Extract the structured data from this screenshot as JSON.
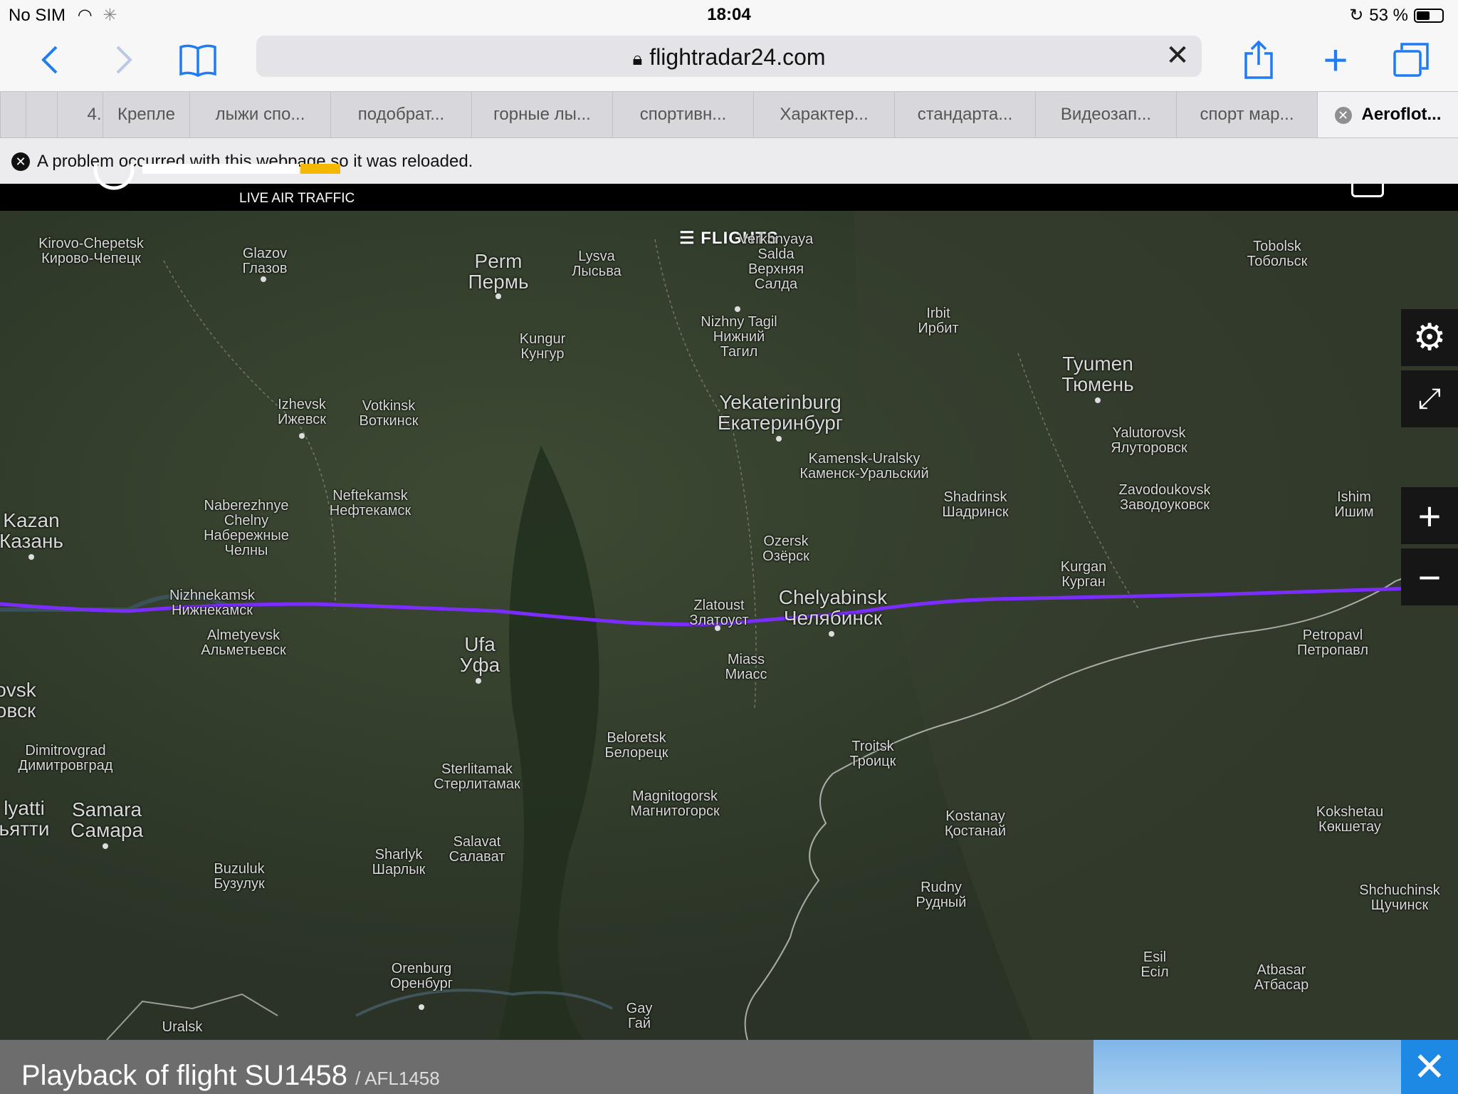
{
  "status": {
    "carrier": "No SIM",
    "time": "18:04",
    "battery": "53 %",
    "battery_level": 0.53
  },
  "toolbar": {
    "url": "flightradar24.com",
    "lock_icon": "lock-icon"
  },
  "tabs": [
    {
      "label": ""
    },
    {
      "label": "4."
    },
    {
      "label": "Крепле"
    },
    {
      "label": "лыжи спо..."
    },
    {
      "label": "подобрат..."
    },
    {
      "label": "горные лы..."
    },
    {
      "label": "спортивн..."
    },
    {
      "label": "Характер..."
    },
    {
      "label": "стандарта..."
    },
    {
      "label": "Видеозап..."
    },
    {
      "label": "спорт мар..."
    },
    {
      "label": "Aeroflot..."
    }
  ],
  "banner": {
    "message": "A problem occurred with this webpage so it was reloaded."
  },
  "site": {
    "tagline": "LIVE AIR TRAFFIC",
    "flights_button": "FLIGHTS"
  },
  "cities": [
    {
      "name": "Kirovo-Chepetsk\nКирово-Чепецк",
      "size": "small"
    },
    {
      "name": "Glazov\nГлазов",
      "size": "small"
    },
    {
      "name": "Perm\nПермь",
      "size": "big"
    },
    {
      "name": "Lysva\nЛысьва",
      "size": "small"
    },
    {
      "name": "Verkhnyaya\nSalda\nВерхняя\nСалда",
      "size": "small"
    },
    {
      "name": "Tobolsk\nТобольск",
      "size": "small"
    },
    {
      "name": "Irbit\nИрбит",
      "size": "small"
    },
    {
      "name": "Nizhny Tagil\nНижний\nТагил",
      "size": "small"
    },
    {
      "name": "Kungur\nКунгур",
      "size": "small"
    },
    {
      "name": "Tyumen\nТюмень",
      "size": "big"
    },
    {
      "name": "Izhevsk\nИжевск",
      "size": "small"
    },
    {
      "name": "Votkinsk\nВоткинск",
      "size": "small"
    },
    {
      "name": "Yekaterinburg\nЕкатеринбург",
      "size": "big"
    },
    {
      "name": "Yalutorovsk\nЯлуторовск",
      "size": "small"
    },
    {
      "name": "Kamensk-Uralsky\nКаменск-Уральский",
      "size": "small"
    },
    {
      "name": "Naberezhnye\nChelny\nНабережные\nЧелны",
      "size": "small"
    },
    {
      "name": "Neftekamsk\nНефтекамск",
      "size": "small"
    },
    {
      "name": "Shadrinsk\nШадринск",
      "size": "small"
    },
    {
      "name": "Zavodoukovsk\nЗаводоуковск",
      "size": "small"
    },
    {
      "name": "Ishim\nИшим",
      "size": "small"
    },
    {
      "name": "Kazan\nКазань",
      "size": "big"
    },
    {
      "name": "Ozersk\nОзёрск",
      "size": "small"
    },
    {
      "name": "Kurgan\nКурган",
      "size": "small"
    },
    {
      "name": "Nizhnekamsk\nНижнекамск",
      "size": "small"
    },
    {
      "name": "Zlatoust\nЗлатоуст",
      "size": "small"
    },
    {
      "name": "Chelyabinsk\nЧелябинск",
      "size": "big"
    },
    {
      "name": "Almetyevsk\nАльметьевск",
      "size": "small"
    },
    {
      "name": "Ufa\nУфа",
      "size": "big"
    },
    {
      "name": "Petropavl\nПетропавл",
      "size": "small"
    },
    {
      "name": "Miass\nМиасс",
      "size": "small"
    },
    {
      "name": "ovsk\nовск",
      "size": "big"
    },
    {
      "name": "Dimitrovgrad\nДимитровград",
      "size": "small"
    },
    {
      "name": "Beloretsk\nБелорецк",
      "size": "small"
    },
    {
      "name": "Troitsk\nТроицк",
      "size": "small"
    },
    {
      "name": "Sterlitamak\nСтерлитамак",
      "size": "small"
    },
    {
      "name": "Magnitogorsk\nМагнитогорск",
      "size": "small"
    },
    {
      "name": "lyatti\nьятти",
      "size": "big"
    },
    {
      "name": "Samara\nСамара",
      "size": "big"
    },
    {
      "name": "Kostanay\nҚостанай",
      "size": "small"
    },
    {
      "name": "Kokshetau\nКөкшетау",
      "size": "small"
    },
    {
      "name": "Salavat\nСалават",
      "size": "small"
    },
    {
      "name": "Sharlyk\nШарлык",
      "size": "small"
    },
    {
      "name": "Buzuluk\nБузулук",
      "size": "small"
    },
    {
      "name": "Rudny\nРудный",
      "size": "small"
    },
    {
      "name": "Shchuchinsk\nЩучинск",
      "size": "small"
    },
    {
      "name": "Orenburg\nОренбург",
      "size": "small"
    },
    {
      "name": "Esil\nЕсіл",
      "size": "small"
    },
    {
      "name": "Atbasar\nАтбасар",
      "size": "small"
    },
    {
      "name": "Gay\nГай",
      "size": "small"
    },
    {
      "name": "Uralsk",
      "size": "small"
    }
  ],
  "route": {
    "color": "#7b2cff"
  },
  "playback": {
    "title": "Playback of flight SU1458",
    "callsign": "/ AFL1458"
  }
}
